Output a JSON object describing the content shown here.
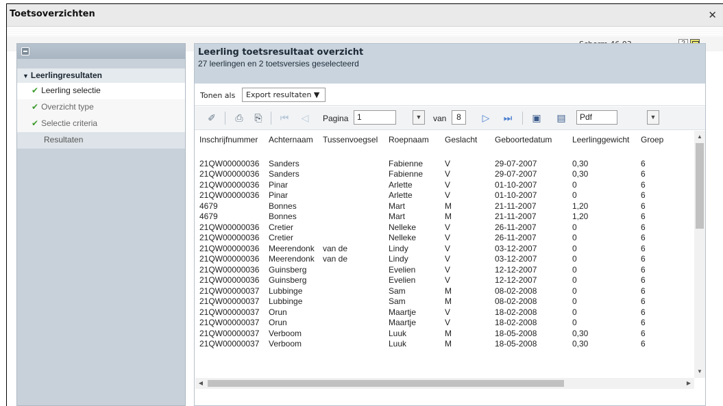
{
  "window": {
    "title": "Toetsoverzichten",
    "close_glyph": "✕",
    "screen_label": "Scherm 46.03",
    "help_label": "?"
  },
  "sidebar": {
    "section_label": "Leerlingresultaten",
    "items": [
      {
        "label": "Leerling selectie",
        "state": "done"
      },
      {
        "label": "Overzicht type",
        "state": "done"
      },
      {
        "label": "Selectie criteria",
        "state": "done"
      },
      {
        "label": "Resultaten",
        "state": "active"
      }
    ]
  },
  "main": {
    "title": "Leerling toetsresultaat overzicht",
    "subtitle": "27 leerlingen en 2 toetsversies geselecteerd",
    "tonen_label": "Tonen als",
    "tonen_value": "Export resultaten ▼",
    "pager": {
      "page_label": "Pagina",
      "page_value": "1",
      "of_label": "van",
      "total_pages": "8",
      "format_value": "Pdf"
    }
  },
  "table": {
    "columns": [
      "Inschrijfnummer",
      "Achternaam",
      "Tussenvoegsel",
      "Roepnaam",
      "Geslacht",
      "Geboortedatum",
      "Leerlinggewicht",
      "Groep"
    ],
    "rows": [
      [
        "21QW00000036",
        "Sanders",
        "",
        "Fabienne",
        "V",
        "29-07-2007",
        "0,30",
        "6"
      ],
      [
        "21QW00000036",
        "Sanders",
        "",
        "Fabienne",
        "V",
        "29-07-2007",
        "0,30",
        "6"
      ],
      [
        "21QW00000036",
        "Pinar",
        "",
        "Arlette",
        "V",
        "01-10-2007",
        "0",
        "6"
      ],
      [
        "21QW00000036",
        "Pinar",
        "",
        "Arlette",
        "V",
        "01-10-2007",
        "0",
        "6"
      ],
      [
        "4679",
        "Bonnes",
        "",
        "Mart",
        "M",
        "21-11-2007",
        "1,20",
        "6"
      ],
      [
        "4679",
        "Bonnes",
        "",
        "Mart",
        "M",
        "21-11-2007",
        "1,20",
        "6"
      ],
      [
        "21QW00000036",
        "Cretier",
        "",
        "Nelleke",
        "V",
        "26-11-2007",
        "0",
        "6"
      ],
      [
        "21QW00000036",
        "Cretier",
        "",
        "Nelleke",
        "V",
        "26-11-2007",
        "0",
        "6"
      ],
      [
        "21QW00000036",
        "Meerendonk",
        "van de",
        "Lindy",
        "V",
        "03-12-2007",
        "0",
        "6"
      ],
      [
        "21QW00000036",
        "Meerendonk",
        "van de",
        "Lindy",
        "V",
        "03-12-2007",
        "0",
        "6"
      ],
      [
        "21QW00000036",
        "Guinsberg",
        "",
        "Evelien",
        "V",
        "12-12-2007",
        "0",
        "6"
      ],
      [
        "21QW00000036",
        "Guinsberg",
        "",
        "Evelien",
        "V",
        "12-12-2007",
        "0",
        "6"
      ],
      [
        "21QW00000037",
        "Lubbinge",
        "",
        "Sam",
        "M",
        "08-02-2008",
        "0",
        "6"
      ],
      [
        "21QW00000037",
        "Lubbinge",
        "",
        "Sam",
        "M",
        "08-02-2008",
        "0",
        "6"
      ],
      [
        "21QW00000037",
        "Orun",
        "",
        "Maartje",
        "V",
        "18-02-2008",
        "0",
        "6"
      ],
      [
        "21QW00000037",
        "Orun",
        "",
        "Maartje",
        "V",
        "18-02-2008",
        "0",
        "6"
      ],
      [
        "21QW00000037",
        "Verboom",
        "",
        "Luuk",
        "M",
        "18-05-2008",
        "0,30",
        "6"
      ],
      [
        "21QW00000037",
        "Verboom",
        "",
        "Luuk",
        "M",
        "18-05-2008",
        "0,30",
        "6"
      ]
    ]
  },
  "icons": {
    "toolbar": [
      "eraser-icon",
      "print-icon",
      "print-settings-icon",
      "first-page-icon",
      "previous-page-icon",
      "next-page-icon",
      "last-page-icon",
      "save-icon",
      "save-as-icon"
    ],
    "accent_colors": {
      "check": "#3a9a2a",
      "header_panel": "#c9d4de",
      "sidebar": "#c8d1d9"
    }
  }
}
